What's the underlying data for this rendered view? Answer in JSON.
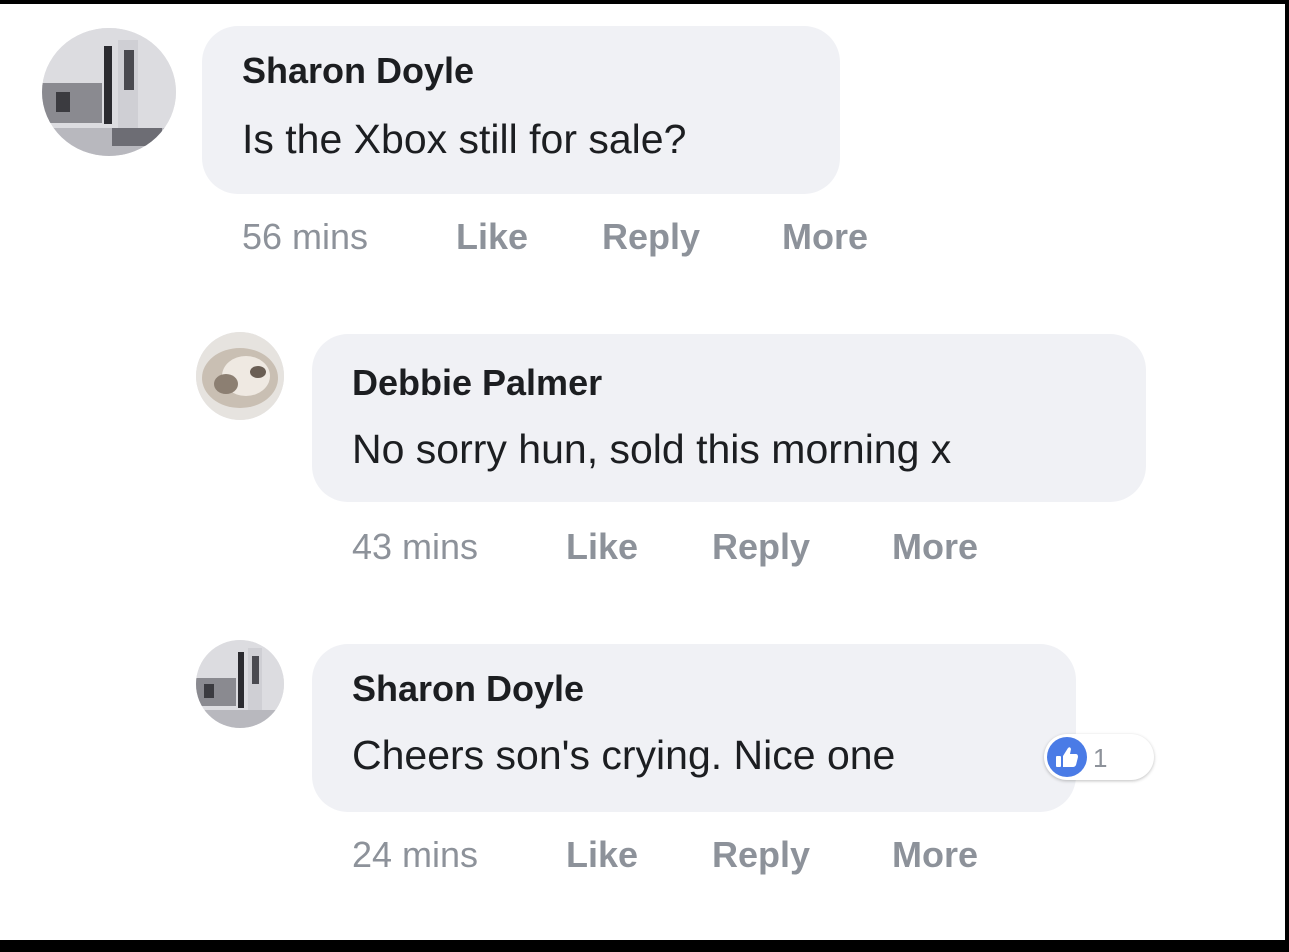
{
  "comments": [
    {
      "author": "Sharon Doyle",
      "text": "Is the Xbox still for sale?",
      "time": "56 mins",
      "like_label": "Like",
      "reply_label": "Reply",
      "more_label": "More"
    },
    {
      "author": "Debbie Palmer",
      "text": "No sorry hun, sold this morning x",
      "time": "43 mins",
      "like_label": "Like",
      "reply_label": "Reply",
      "more_label": "More"
    },
    {
      "author": "Sharon Doyle",
      "text": "Cheers son's crying. Nice one",
      "time": "24 mins",
      "like_label": "Like",
      "reply_label": "Reply",
      "more_label": "More",
      "reaction": {
        "icon": "thumbs-up-icon",
        "count": "1"
      }
    }
  ],
  "colors": {
    "bubble": "#f0f1f5",
    "text": "#1c1e21",
    "meta": "#8d929a",
    "like_accent": "#4a7be6"
  }
}
